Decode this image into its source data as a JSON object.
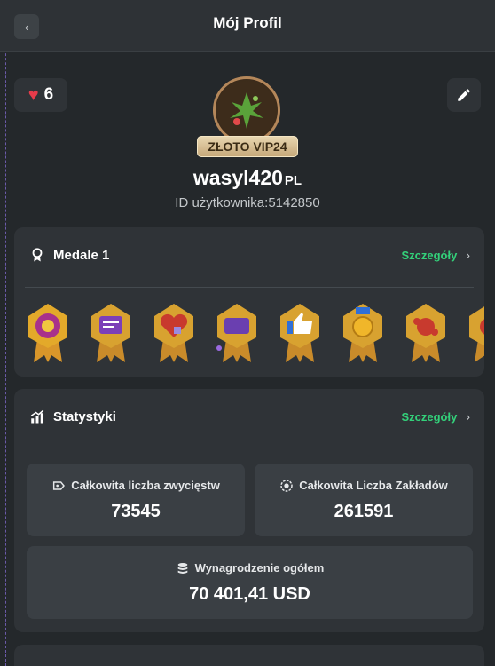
{
  "header": {
    "title": "Mój Profil",
    "back_icon": "chevron-left-icon"
  },
  "profile": {
    "likes": "6",
    "vip_badge": "ZŁOTO VIP24",
    "username": "wasyl420",
    "country_code": "PL",
    "user_id": "ID użytkownika:5142850",
    "colors": {
      "heart": "#e63b4a",
      "vip_gold": "#c6a97a"
    }
  },
  "medals": {
    "title": "Medale 1",
    "details_label": "Szczegóły",
    "items": [
      "medal-1",
      "medal-2",
      "medal-3",
      "medal-4",
      "medal-5",
      "medal-6",
      "medal-7",
      "medal-8"
    ]
  },
  "stats": {
    "title": "Statystyki",
    "details_label": "Szczegóły",
    "total_wins_label": "Całkowita liczba zwycięstw",
    "total_wins_value": "73545",
    "total_bets_label": "Całkowita Liczba Zakładów",
    "total_bets_value": "261591",
    "total_reward_label": "Wynagrodzenie ogółem",
    "total_reward_value": "70 401,41 USD"
  },
  "colors": {
    "accent_green": "#33d17a",
    "background": "#24282b",
    "card": "#2f3337"
  }
}
